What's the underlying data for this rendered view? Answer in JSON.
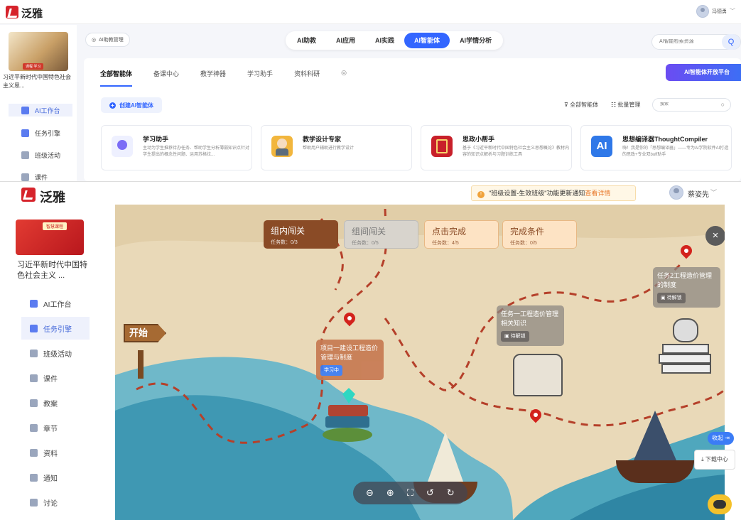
{
  "top": {
    "logo_text": "泛雅",
    "user_name": "冯德勇",
    "course_title": "习近平新时代中国特色社会主义思...",
    "course_badge": "课程 学习",
    "sidebar": [
      {
        "label": "AI工作台",
        "active": true
      },
      {
        "label": "任务引擎",
        "active": false
      },
      {
        "label": "班级活动",
        "active": false
      },
      {
        "label": "课件",
        "active": false
      }
    ],
    "ai_mgmt_label": "AI助教管理",
    "main_tabs": [
      {
        "label": "AI助教",
        "active": false
      },
      {
        "label": "AI应用",
        "active": false
      },
      {
        "label": "AI实践",
        "active": false
      },
      {
        "label": "AI智能体",
        "active": true
      },
      {
        "label": "AI学情分析",
        "active": false
      }
    ],
    "search_placeholder": "AI智能检索资源",
    "sub_tabs": [
      {
        "label": "全部智能体",
        "active": true
      },
      {
        "label": "备课中心",
        "active": false
      },
      {
        "label": "教学神器",
        "active": false
      },
      {
        "label": "学习助手",
        "active": false
      },
      {
        "label": "资料科研",
        "active": false
      }
    ],
    "platform_btn": "AI智能体开放平台",
    "create_btn": "创建AI智能体",
    "filter_all": "全部智能体",
    "batch_mgmt": "批量管理",
    "filter_search_placeholder": "搜索",
    "cards": [
      {
        "title": "学习助手",
        "desc": "主动为学生推荐待办任务、帮助学生分析薄弱知识点针对学生提出的概念性问题、运用苏格拉...",
        "icon": "bulb-icon",
        "color": "#eef0ff"
      },
      {
        "title": "教学设计专家",
        "desc": "帮助用户辅助进行教学设计",
        "icon": "teacher-avatar-icon",
        "color": "#f2b63d"
      },
      {
        "title": "思政小帮手",
        "desc": "基于《习近平新时代中国特色社会主义思想概论》教材内容的知识点解析与习题训练工具",
        "icon": "book-icon",
        "color": "#c8202a"
      },
      {
        "title": "思想编译器ThoughtCompiler",
        "desc": "嗨！我是你的「思想编译器」——专为AI学院软件AI打造的思政+专业双buff助手",
        "icon": "ai-icon",
        "color": "#2f78e8"
      }
    ]
  },
  "bottom": {
    "logo_text": "泛雅",
    "notice": "\"班级设置-生效班级\"功能更新通知",
    "notice_link": "查看详情",
    "user_name": "蔡姿先",
    "course_title": "习近平新时代中国特色社会主义 ...",
    "course_badge": "智慧课程",
    "sidebar": [
      {
        "label": "AI工作台",
        "active": false
      },
      {
        "label": "任务引擎",
        "active": true
      },
      {
        "label": "班级活动",
        "active": false
      },
      {
        "label": "课件",
        "active": false
      },
      {
        "label": "教案",
        "active": false
      },
      {
        "label": "章节",
        "active": false
      },
      {
        "label": "资料",
        "active": false
      },
      {
        "label": "通知",
        "active": false
      },
      {
        "label": "讨论",
        "active": false
      }
    ],
    "task_buttons": [
      {
        "label": "组内闯关",
        "count": "任务数：0/3",
        "style": "brown"
      },
      {
        "label": "组间闯关",
        "count": "任务数：0/5",
        "style": "grey"
      },
      {
        "label": "点击完成",
        "count": "任务数：4/5",
        "style": "peach"
      },
      {
        "label": "完成条件",
        "count": "任务数：0/5",
        "style": "peach"
      }
    ],
    "start_sign": "开始",
    "station1_title": "项目一建设工程造价管理与制度",
    "station1_status": "学习中",
    "station2_title": "任务一工程造价管理相关知识",
    "station2_status": "待解锁",
    "station3_title": "任务2工程造价管理的制度",
    "station3_status": "待解锁",
    "collapse_label": "收起",
    "download_label": "下载中心"
  }
}
